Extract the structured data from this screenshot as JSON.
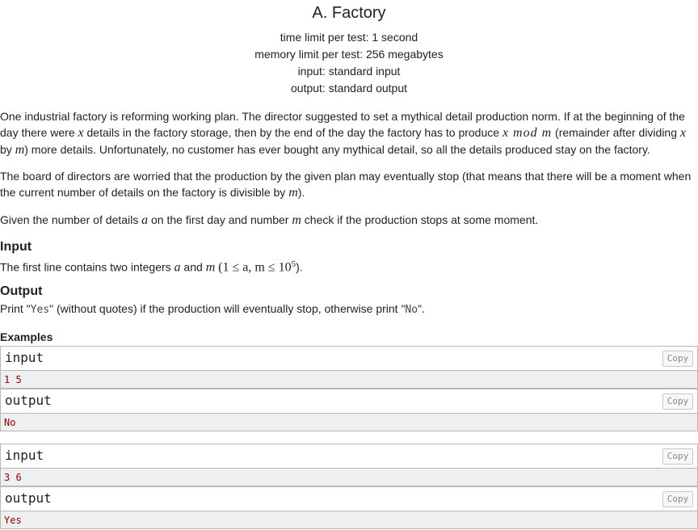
{
  "problem": {
    "title": "A. Factory",
    "time_limit": "time limit per test: 1 second",
    "memory_limit": "memory limit per test: 256 megabytes",
    "input_file": "input: standard input",
    "output_file": "output: standard output"
  },
  "statement": {
    "p1_a": "One industrial factory is reforming working plan. The director suggested to set a mythical detail production norm. If at the beginning of the day there were ",
    "p1_var_x": "x",
    "p1_b": " details in the factory storage, then by the end of the day the factory has to produce ",
    "p1_mod": "x mod m",
    "p1_c": " (remainder after dividing ",
    "p1_var_x2": "x",
    "p1_d": " by ",
    "p1_var_m": "m",
    "p1_e": ") more details. Unfortunately, no customer has ever bought any mythical detail, so all the details produced stay on the factory.",
    "p2_a": "The board of directors are worried that the production by the given plan may eventually stop (that means that there will be a moment when the current number of details on the factory is divisible by ",
    "p2_var_m": "m",
    "p2_b": ").",
    "p3_a": "Given the number of details ",
    "p3_var_a": "a",
    "p3_b": " on the first day and number ",
    "p3_var_m": "m",
    "p3_c": " check if the production stops at some moment."
  },
  "input_section": {
    "title": "Input",
    "text_a": "The first line contains two integers ",
    "var_a": "a",
    "text_b": " and ",
    "var_m": "m",
    "constraint": "(1 ≤ a, m ≤ 10",
    "exp": "5",
    "text_c": ")."
  },
  "output_section": {
    "title": "Output",
    "text_a": "Print \"",
    "yes": "Yes",
    "text_b": "\" (without quotes) if the production will eventually stop, otherwise print \"",
    "no": "No",
    "text_c": "\"."
  },
  "examples": {
    "title": "Examples",
    "copy_label": "Copy",
    "input_label": "input",
    "output_label": "output",
    "items": [
      {
        "input": "1 5",
        "output": "No"
      },
      {
        "input": "3 6",
        "output": "Yes"
      }
    ]
  }
}
